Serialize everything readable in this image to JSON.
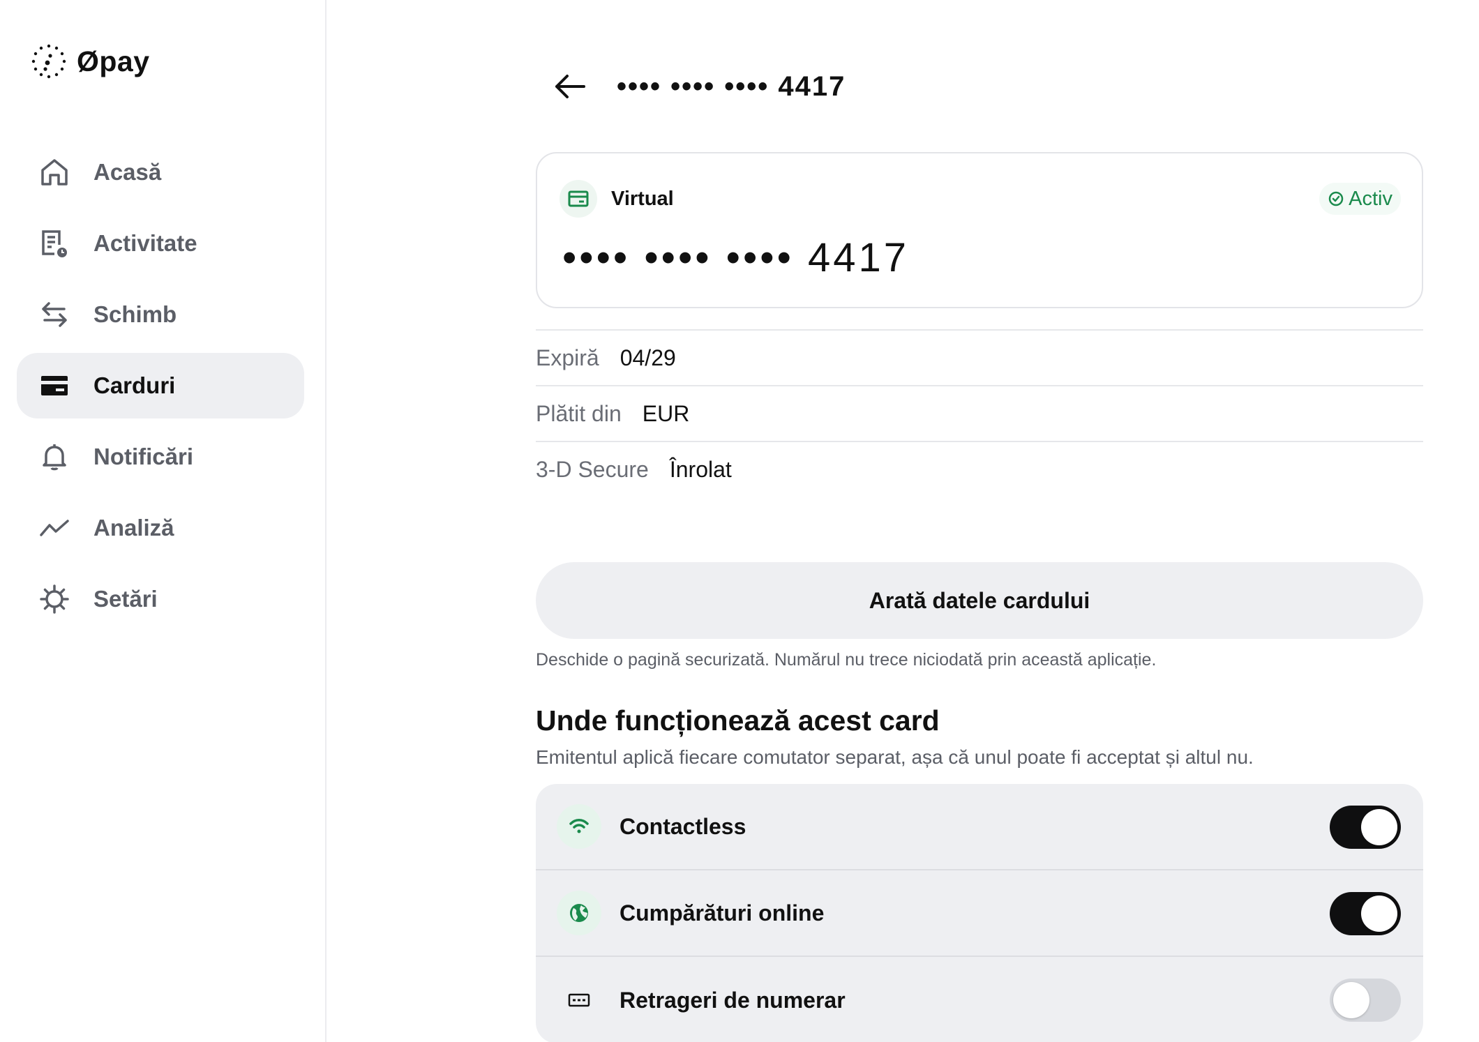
{
  "app": {
    "name": "Øpay"
  },
  "sidebar": {
    "items": [
      {
        "label": "Acasă",
        "icon": "home-icon"
      },
      {
        "label": "Activitate",
        "icon": "activity-icon"
      },
      {
        "label": "Schimb",
        "icon": "exchange-icon"
      },
      {
        "label": "Carduri",
        "icon": "card-icon",
        "active": true
      },
      {
        "label": "Notificări",
        "icon": "bell-icon"
      },
      {
        "label": "Analiză",
        "icon": "chart-icon"
      },
      {
        "label": "Setări",
        "icon": "gear-icon"
      }
    ]
  },
  "header": {
    "title": "•••• •••• •••• 4417"
  },
  "card": {
    "type": "Virtual",
    "status": "Activ",
    "number": "•••• •••• •••• 4417",
    "accent_color": "#1a8a4c"
  },
  "details": [
    {
      "label": "Expiră",
      "value": "04/29"
    },
    {
      "label": "Plătit din",
      "value": "EUR"
    },
    {
      "label": "3-D Secure",
      "value": "Înrolat"
    }
  ],
  "show_button": {
    "label": "Arată datele cardului",
    "hint": "Deschide o pagină securizată. Numărul nu trece niciodată prin această aplicație."
  },
  "usage": {
    "title": "Unde funcționează acest card",
    "subtitle": "Emitentul aplică fiecare comutator separat, așa că unul poate fi acceptat și altul nu.",
    "toggles": [
      {
        "label": "Contactless",
        "icon": "contactless-icon",
        "enabled": true
      },
      {
        "label": "Cumpărături online",
        "icon": "globe-icon",
        "enabled": true
      },
      {
        "label": "Retrageri de numerar",
        "icon": "cash-icon",
        "enabled": false
      }
    ]
  }
}
